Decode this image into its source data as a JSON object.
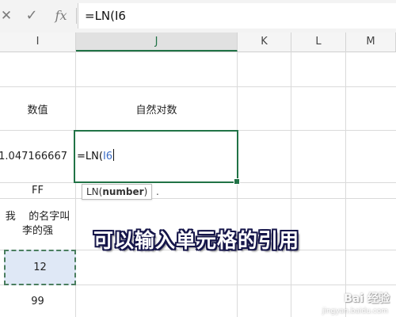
{
  "formula_bar": {
    "cancel_icon": "close-icon",
    "enter_icon": "check-icon",
    "fx_label": "fx",
    "formula": "=LN(I6"
  },
  "columns": [
    {
      "label": "I",
      "active": false
    },
    {
      "label": "J",
      "active": true
    },
    {
      "label": "K",
      "active": false
    },
    {
      "label": "L",
      "active": false
    },
    {
      "label": "M",
      "active": false
    }
  ],
  "cells": {
    "I_header": "数值",
    "J_header": "自然对数",
    "I6": "1.047166667",
    "J6_editing": "=LN(",
    "J6_ref": "I6",
    "I7": "FF",
    "I8_line1": "我    的名字叫",
    "I8_line2": "李的强",
    "I9": "12",
    "I10": "99"
  },
  "tooltip": {
    "function_name": "LN(",
    "argument": "number",
    "close": ")",
    "extra": "."
  },
  "caption": "可以输入单元格的引用",
  "watermark": {
    "brand": "Bai 经验",
    "url": "jingyan.baidu.com"
  },
  "colors": {
    "accent": "#217346",
    "reference": "#3e6fc6",
    "selection_fill": "#dfe8f6"
  }
}
